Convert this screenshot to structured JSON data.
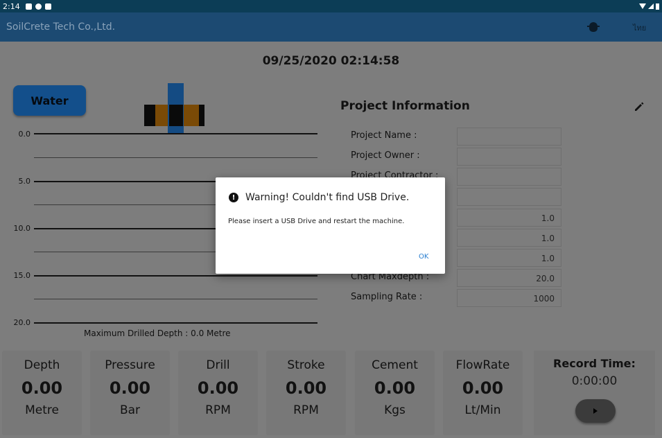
{
  "status_bar": {
    "time": "2:14"
  },
  "app_bar": {
    "title": "SoilCrete Tech Co.,Ltd.",
    "language_label": "ไทย"
  },
  "datetime": "09/25/2020 02:14:58",
  "water_button": {
    "label": "Water"
  },
  "depth_chart": {
    "ticks": [
      "0.0",
      "5.0",
      "10.0",
      "15.0",
      "20.0"
    ],
    "max_drilled_depth": "Maximum Drilled Depth : 0.0 Metre"
  },
  "project_info": {
    "title": "Project Information",
    "fields": [
      {
        "label": "Project Name :",
        "value": ""
      },
      {
        "label": "Project Owner :",
        "value": ""
      },
      {
        "label": "Project Contractor :",
        "value": ""
      },
      {
        "label": "",
        "value": ""
      },
      {
        "label": "",
        "value": "1.0"
      },
      {
        "label": "",
        "value": "1.0"
      },
      {
        "label": "",
        "value": "1.0"
      },
      {
        "label": "Chart Maxdepth :",
        "value": "20.0"
      },
      {
        "label": "Sampling Rate :",
        "value": "1000"
      }
    ]
  },
  "metrics": [
    {
      "label": "Depth",
      "value": "0.00",
      "unit": "Metre"
    },
    {
      "label": "Pressure",
      "value": "0.00",
      "unit": "Bar"
    },
    {
      "label": "Drill",
      "value": "0.00",
      "unit": "RPM"
    },
    {
      "label": "Stroke",
      "value": "0.00",
      "unit": "RPM"
    },
    {
      "label": "Cement",
      "value": "0.00",
      "unit": "Kgs"
    },
    {
      "label": "FlowRate",
      "value": "0.00",
      "unit": "Lt/Min"
    }
  ],
  "record": {
    "label": "Record Time:",
    "time": "0:00:00"
  },
  "dialog": {
    "title": "Warning! Couldn't find USB Drive.",
    "message": "Please insert a USB Drive and restart the machine.",
    "ok_label": "OK"
  },
  "colors": {
    "status_bar": "#0c3d56",
    "app_bar": "#1c4a72",
    "water_button": "#134f8b",
    "drill_pipe": "#144b83",
    "drill_band_black": "#0a0a0a",
    "drill_band_orange": "#7a4a06",
    "dialog_ok": "#2a7fd0"
  }
}
